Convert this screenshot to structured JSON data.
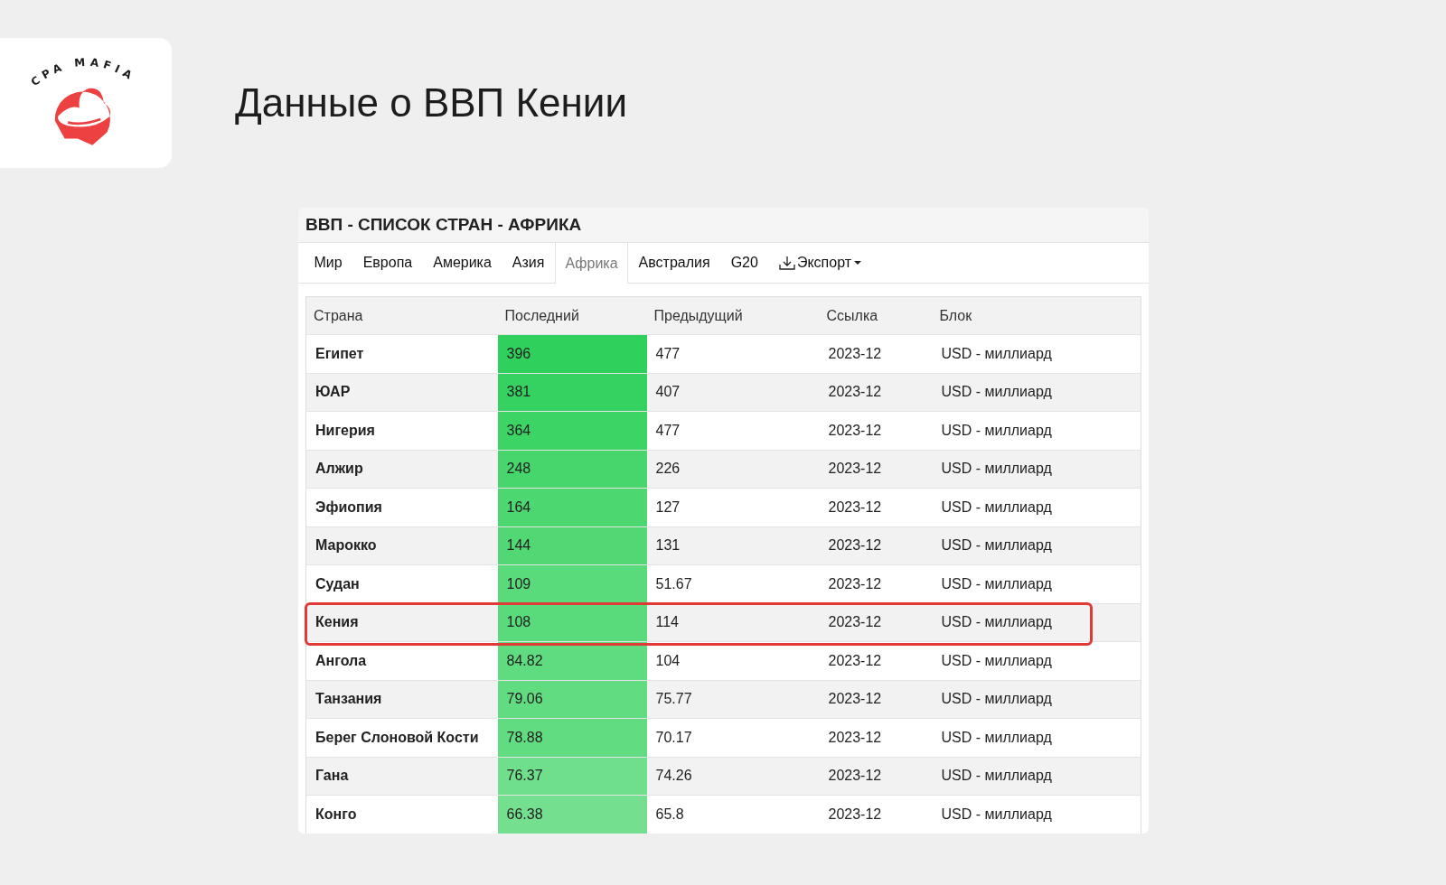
{
  "logo": {
    "text": "CPA MAFIA"
  },
  "title": "Данные о ВВП Кении",
  "panel": {
    "heading": "ВВП - СПИСОК СТРАН - АФРИКА",
    "tabs": [
      {
        "label": "Мир",
        "selected": false
      },
      {
        "label": "Европа",
        "selected": false
      },
      {
        "label": "Америка",
        "selected": false
      },
      {
        "label": "Азия",
        "selected": false
      },
      {
        "label": "Африка",
        "selected": true
      },
      {
        "label": "Австралия",
        "selected": false
      },
      {
        "label": "G20",
        "selected": false
      }
    ],
    "export": {
      "label": "Экспорт"
    },
    "table": {
      "columns": [
        "Страна",
        "Последний",
        "Предыдущий",
        "Ссылка",
        "Блок"
      ],
      "rows": [
        {
          "country": "Египет",
          "latest": "396",
          "color": "#2fd15c",
          "previous": "477",
          "reference": "2023-12",
          "unit": "USD - миллиард",
          "highlighted": false
        },
        {
          "country": "ЮАР",
          "latest": "381",
          "color": "#36d261",
          "previous": "407",
          "reference": "2023-12",
          "unit": "USD - миллиард",
          "highlighted": false
        },
        {
          "country": "Нигерия",
          "latest": "364",
          "color": "#3dd466",
          "previous": "477",
          "reference": "2023-12",
          "unit": "USD - миллиард",
          "highlighted": false
        },
        {
          "country": "Алжир",
          "latest": "248",
          "color": "#46d66c",
          "previous": "226",
          "reference": "2023-12",
          "unit": "USD - миллиард",
          "highlighted": false
        },
        {
          "country": "Эфиопия",
          "latest": "164",
          "color": "#4dd771",
          "previous": "127",
          "reference": "2023-12",
          "unit": "USD - миллиард",
          "highlighted": false
        },
        {
          "country": "Марокко",
          "latest": "144",
          "color": "#51d874",
          "previous": "131",
          "reference": "2023-12",
          "unit": "USD - миллиард",
          "highlighted": false
        },
        {
          "country": "Судан",
          "latest": "109",
          "color": "#5adb7b",
          "previous": "51.67",
          "reference": "2023-12",
          "unit": "USD - миллиард",
          "highlighted": false
        },
        {
          "country": "Кения",
          "latest": "108",
          "color": "#5adb7b",
          "previous": "114",
          "reference": "2023-12",
          "unit": "USD - миллиард",
          "highlighted": true
        },
        {
          "country": "Ангола",
          "latest": "84.82",
          "color": "#5fdc7f",
          "previous": "104",
          "reference": "2023-12",
          "unit": "USD - миллиард",
          "highlighted": false
        },
        {
          "country": "Танзания",
          "latest": "79.06",
          "color": "#62dc81",
          "previous": "75.77",
          "reference": "2023-12",
          "unit": "USD - миллиард",
          "highlighted": false
        },
        {
          "country": "Берег Слоновой Кости",
          "latest": "78.88",
          "color": "#62dc81",
          "previous": "70.17",
          "reference": "2023-12",
          "unit": "USD - миллиард",
          "highlighted": false
        },
        {
          "country": "Гана",
          "latest": "76.37",
          "color": "#6fdf8b",
          "previous": "74.26",
          "reference": "2023-12",
          "unit": "USD - миллиард",
          "highlighted": false
        },
        {
          "country": "Конго",
          "latest": "66.38",
          "color": "#74e08f",
          "previous": "65.8",
          "reference": "2023-12",
          "unit": "USD - миллиард",
          "highlighted": false
        }
      ]
    }
  }
}
